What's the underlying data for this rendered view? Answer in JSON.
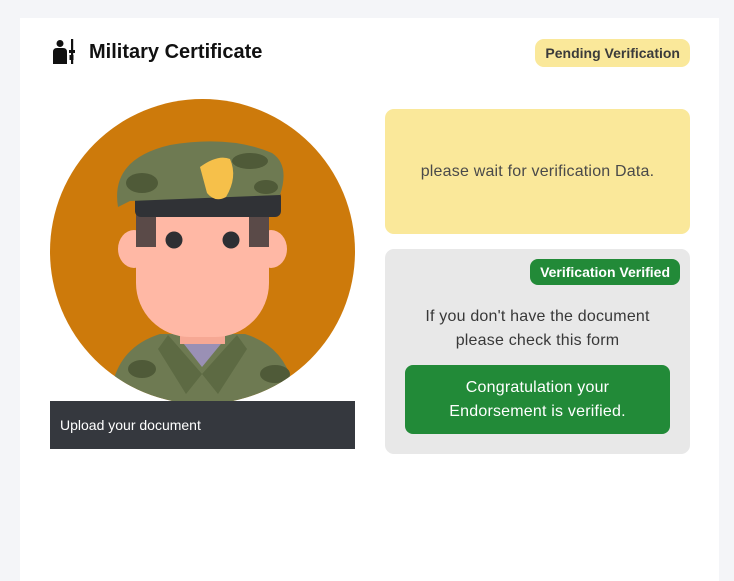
{
  "header": {
    "title": "Military Certificate",
    "icon": "soldier-with-rifle-icon",
    "status_badge": "Pending Verification"
  },
  "photo": {
    "image": "soldier-avatar",
    "upload_label": "Upload your document"
  },
  "wait_panel": {
    "message": "please wait for verification Data."
  },
  "verification_panel": {
    "badge": "Verification Verified",
    "instruction_line1": "If you don't have the document",
    "instruction_line2": "please check this form",
    "button_line1": "Congratulation your",
    "button_line2": "Endorsement is verified."
  },
  "colors": {
    "pending": "#fae89a",
    "verified": "#228a38",
    "upload_bar": "#35383e",
    "avatar_bg": "#cd7a0b"
  }
}
